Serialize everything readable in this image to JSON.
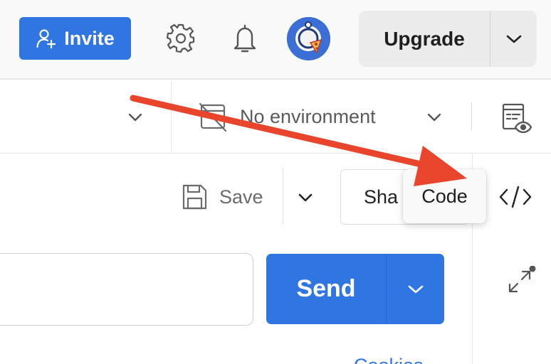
{
  "header": {
    "invite_label": "Invite",
    "upgrade_label": "Upgrade",
    "icons": [
      "add-user-icon",
      "gear-icon",
      "bell-icon",
      "avatar",
      "chevron-down-icon"
    ]
  },
  "environment_bar": {
    "environment_label": "No environment",
    "icons": [
      "chevron-down-icon",
      "no-environment-icon",
      "environment-quick-look-icon"
    ]
  },
  "request_toolbar": {
    "save_label": "Save",
    "share_label": "Sha",
    "tooltip_label": "Code",
    "icons": [
      "save-icon",
      "chevron-down-icon",
      "code-icon"
    ]
  },
  "url_row": {
    "url_value": "",
    "send_label": "Send",
    "cookies_label": "Cookies",
    "icons": [
      "chevron-down-icon",
      "expand-icon"
    ]
  },
  "annotation": {
    "arrow_color": "#e8452c",
    "icons": [
      "annotation-arrow"
    ]
  },
  "colors": {
    "accent": "#2f76e3",
    "header_bg": "#f9f9f9",
    "upgrade_bg": "#ececec"
  }
}
